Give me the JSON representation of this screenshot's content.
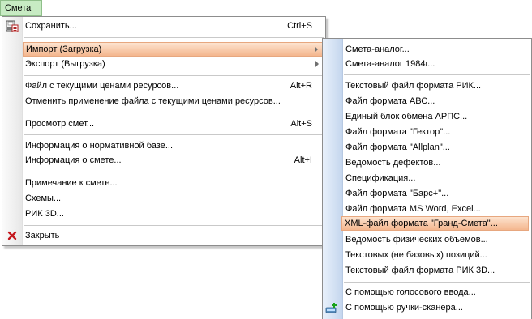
{
  "menubar": {
    "top_label": "Смета"
  },
  "main_menu": {
    "save": {
      "label": "Сохранить...",
      "shortcut": "Ctrl+S"
    },
    "import": {
      "label": "Импорт (Загрузка)"
    },
    "export": {
      "label": "Экспорт (Выгрузка)"
    },
    "apply_prices": {
      "label": "Файл с текущими ценами ресурсов...",
      "shortcut": "Alt+R"
    },
    "cancel_prices": {
      "label": "Отменить применение файла с текущими ценами ресурсов..."
    },
    "view_estimates": {
      "label": "Просмотр смет...",
      "shortcut": "Alt+S"
    },
    "normative_info": {
      "label": "Информация о нормативной базе..."
    },
    "estimate_info": {
      "label": "Информация о смете...",
      "shortcut": "Alt+I"
    },
    "note": {
      "label": "Примечание к смете..."
    },
    "schemes": {
      "label": "Схемы..."
    },
    "rik3d": {
      "label": "РИК 3D..."
    },
    "close": {
      "label": "Закрыть"
    }
  },
  "import_menu": {
    "items": [
      "Смета-аналог...",
      "Смета-аналог 1984г...",
      "Текстовый файл формата РИК...",
      "Файл формата АВС...",
      "Единый блок обмена АРПС...",
      "Файл формата \"Гектор\"...",
      "Файл формата \"Allplan\"...",
      "Ведомость дефектов...",
      "Спецификация...",
      "Файл формата \"Барс+\"...",
      "Файл формата MS Word, Excel...",
      "XML-файл формата \"Гранд-Смета\"...",
      "Ведомость физических объемов...",
      "Текстовых (не базовых) позиций...",
      "Текстовый файл формата РИК 3D...",
      "С помощью голосового ввода...",
      "С помощью ручки-сканера..."
    ]
  }
}
